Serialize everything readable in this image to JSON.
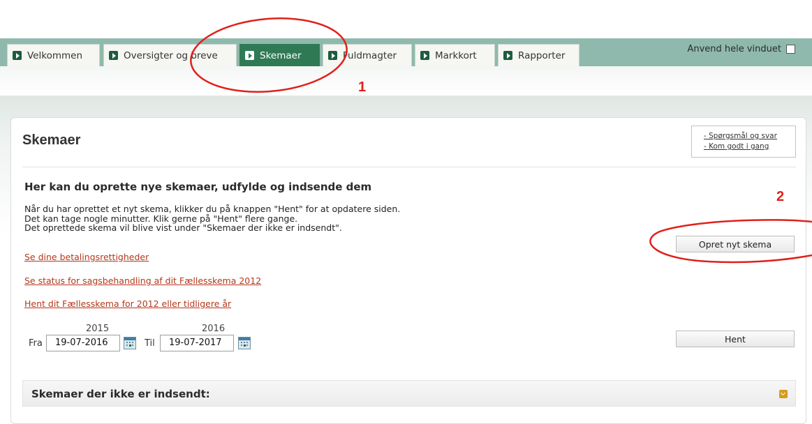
{
  "tabs": [
    {
      "label": "Velkommen",
      "active": false
    },
    {
      "label": "Oversigter og breve",
      "active": false
    },
    {
      "label": "Skemaer",
      "active": true
    },
    {
      "label": "Fuldmagter",
      "active": false
    },
    {
      "label": "Markkort",
      "active": false
    },
    {
      "label": "Rapporter",
      "active": false
    }
  ],
  "whole_window": {
    "label": "Anvend hele vinduet",
    "checked": false
  },
  "annotations": {
    "one": "1",
    "two": "2"
  },
  "page": {
    "title": "Skemaer",
    "help_links": [
      "- Spørgsmål og svar",
      "- Kom godt i gang"
    ],
    "heading": "Her kan du oprette nye skemaer, udfylde og indsende dem",
    "info_lines": [
      "Når du har oprettet et nyt skema, klikker du på knappen \"Hent\" for at opdatere siden.",
      "Det kan tage nogle minutter. Klik gerne på \"Hent\" flere gange.",
      "Det oprettede skema vil blive vist under \"Skemaer der ikke er indsendt\"."
    ],
    "links": [
      "Se dine betalingsrettigheder",
      "Se status for sagsbehandling af dit Fællesskema 2012",
      "Hent dit Fællesskema for 2012 eller tidligere år"
    ],
    "create_button": "Opret nyt skema",
    "fetch_button": "Hent",
    "date_filter": {
      "from_label": "Fra",
      "from_year": "2015",
      "from_value": "19-07-2016",
      "to_label": "Til",
      "to_year": "2016",
      "to_value": "19-07-2017"
    },
    "section_title": "Skemaer der ikke er indsendt:"
  },
  "colors": {
    "tabbar": "#8fb9ac",
    "active_tab": "#2f7a55",
    "link": "#b5371a",
    "annotation": "#e0201a",
    "chevron": "#d49b1e"
  }
}
